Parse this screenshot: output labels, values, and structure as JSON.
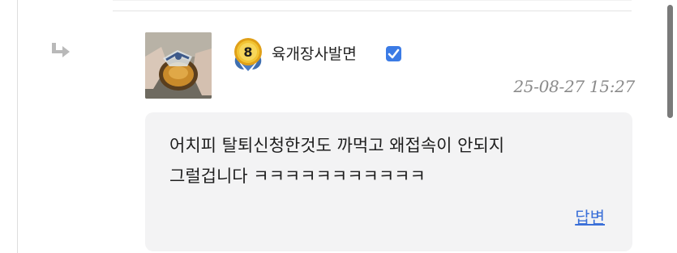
{
  "comment": {
    "author": "육개장사발면",
    "level": "8",
    "timestamp": "25-08-27 15:27",
    "body_lines": [
      "어치피 탈퇴신청한것도 까먹고 왜접속이 안되지",
      "그럴겁니다 ㅋㅋㅋㅋㅋㅋㅋㅋㅋㅋㅋ"
    ],
    "reply_label": "답변"
  },
  "colors": {
    "verified_badge": "#3b7be5",
    "reply_link": "#3a6fd8",
    "bubble_bg": "#f3f3f4",
    "timestamp": "#8a8a8a"
  },
  "icons": {
    "reply_indicator": "reply-arrow-icon",
    "verified": "check-badge-icon",
    "level": "level-medal-icon"
  }
}
